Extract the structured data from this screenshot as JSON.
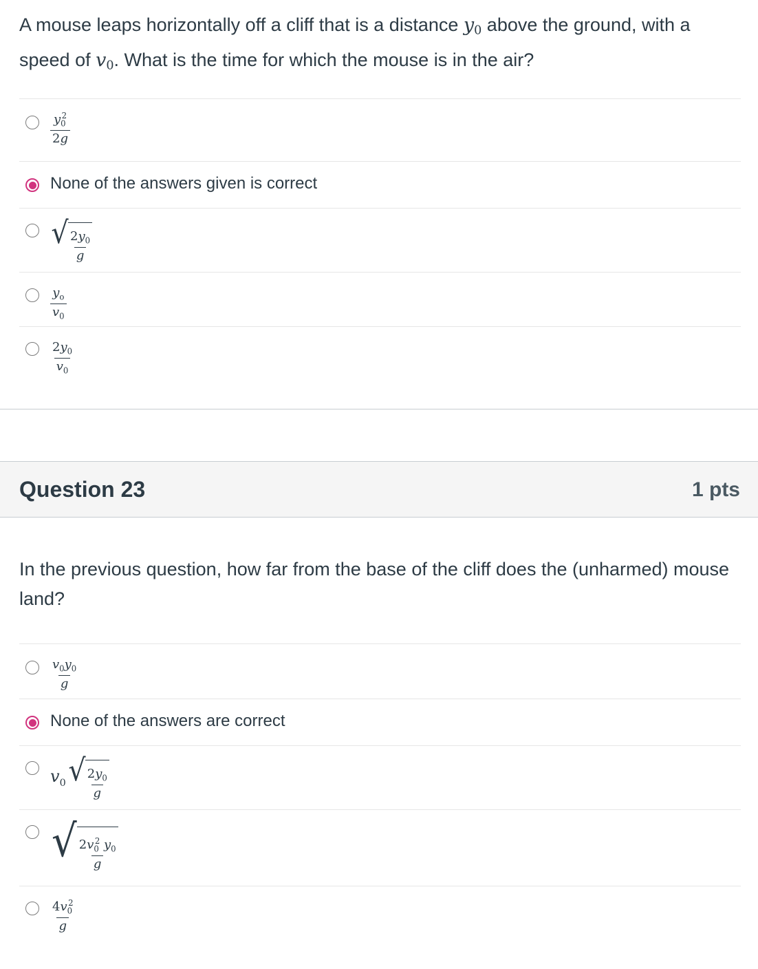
{
  "q22": {
    "text_part1": "A mouse leaps horizontally off a cliff that is a distance ",
    "text_part2": " above the ground, with a speed of ",
    "text_part3": ". What is the time for which the mouse is in the air?",
    "math_y0": "y",
    "math_v0": "v",
    "sub0": "0",
    "answers": [
      {
        "id": "a1",
        "selected": false,
        "latex": "y0^2/(2g)"
      },
      {
        "id": "a2",
        "selected": true,
        "label": "None of the answers given is correct"
      },
      {
        "id": "a3",
        "selected": false,
        "latex": "sqrt(2y0/g)"
      },
      {
        "id": "a4",
        "selected": false,
        "latex": "yo/v0"
      },
      {
        "id": "a5",
        "selected": false,
        "latex": "2y0/v0"
      }
    ]
  },
  "q23": {
    "title": "Question 23",
    "points": "1 pts",
    "text": "In the previous question, how far from the base of the cliff does the (unharmed) mouse land?",
    "answers": [
      {
        "id": "b1",
        "selected": false,
        "latex": "v0y0/g"
      },
      {
        "id": "b2",
        "selected": true,
        "label": "None of the answers are correct"
      },
      {
        "id": "b3",
        "selected": false,
        "latex": "v0 sqrt(2y0/g)"
      },
      {
        "id": "b4",
        "selected": false,
        "latex": "sqrt(2v0^2 y0/g)"
      },
      {
        "id": "b5",
        "selected": false,
        "latex": "4v0^2/g"
      }
    ]
  },
  "colors": {
    "selected_radio": "#d1337e",
    "text": "#2d3b45",
    "header_bg": "#f5f5f5"
  }
}
